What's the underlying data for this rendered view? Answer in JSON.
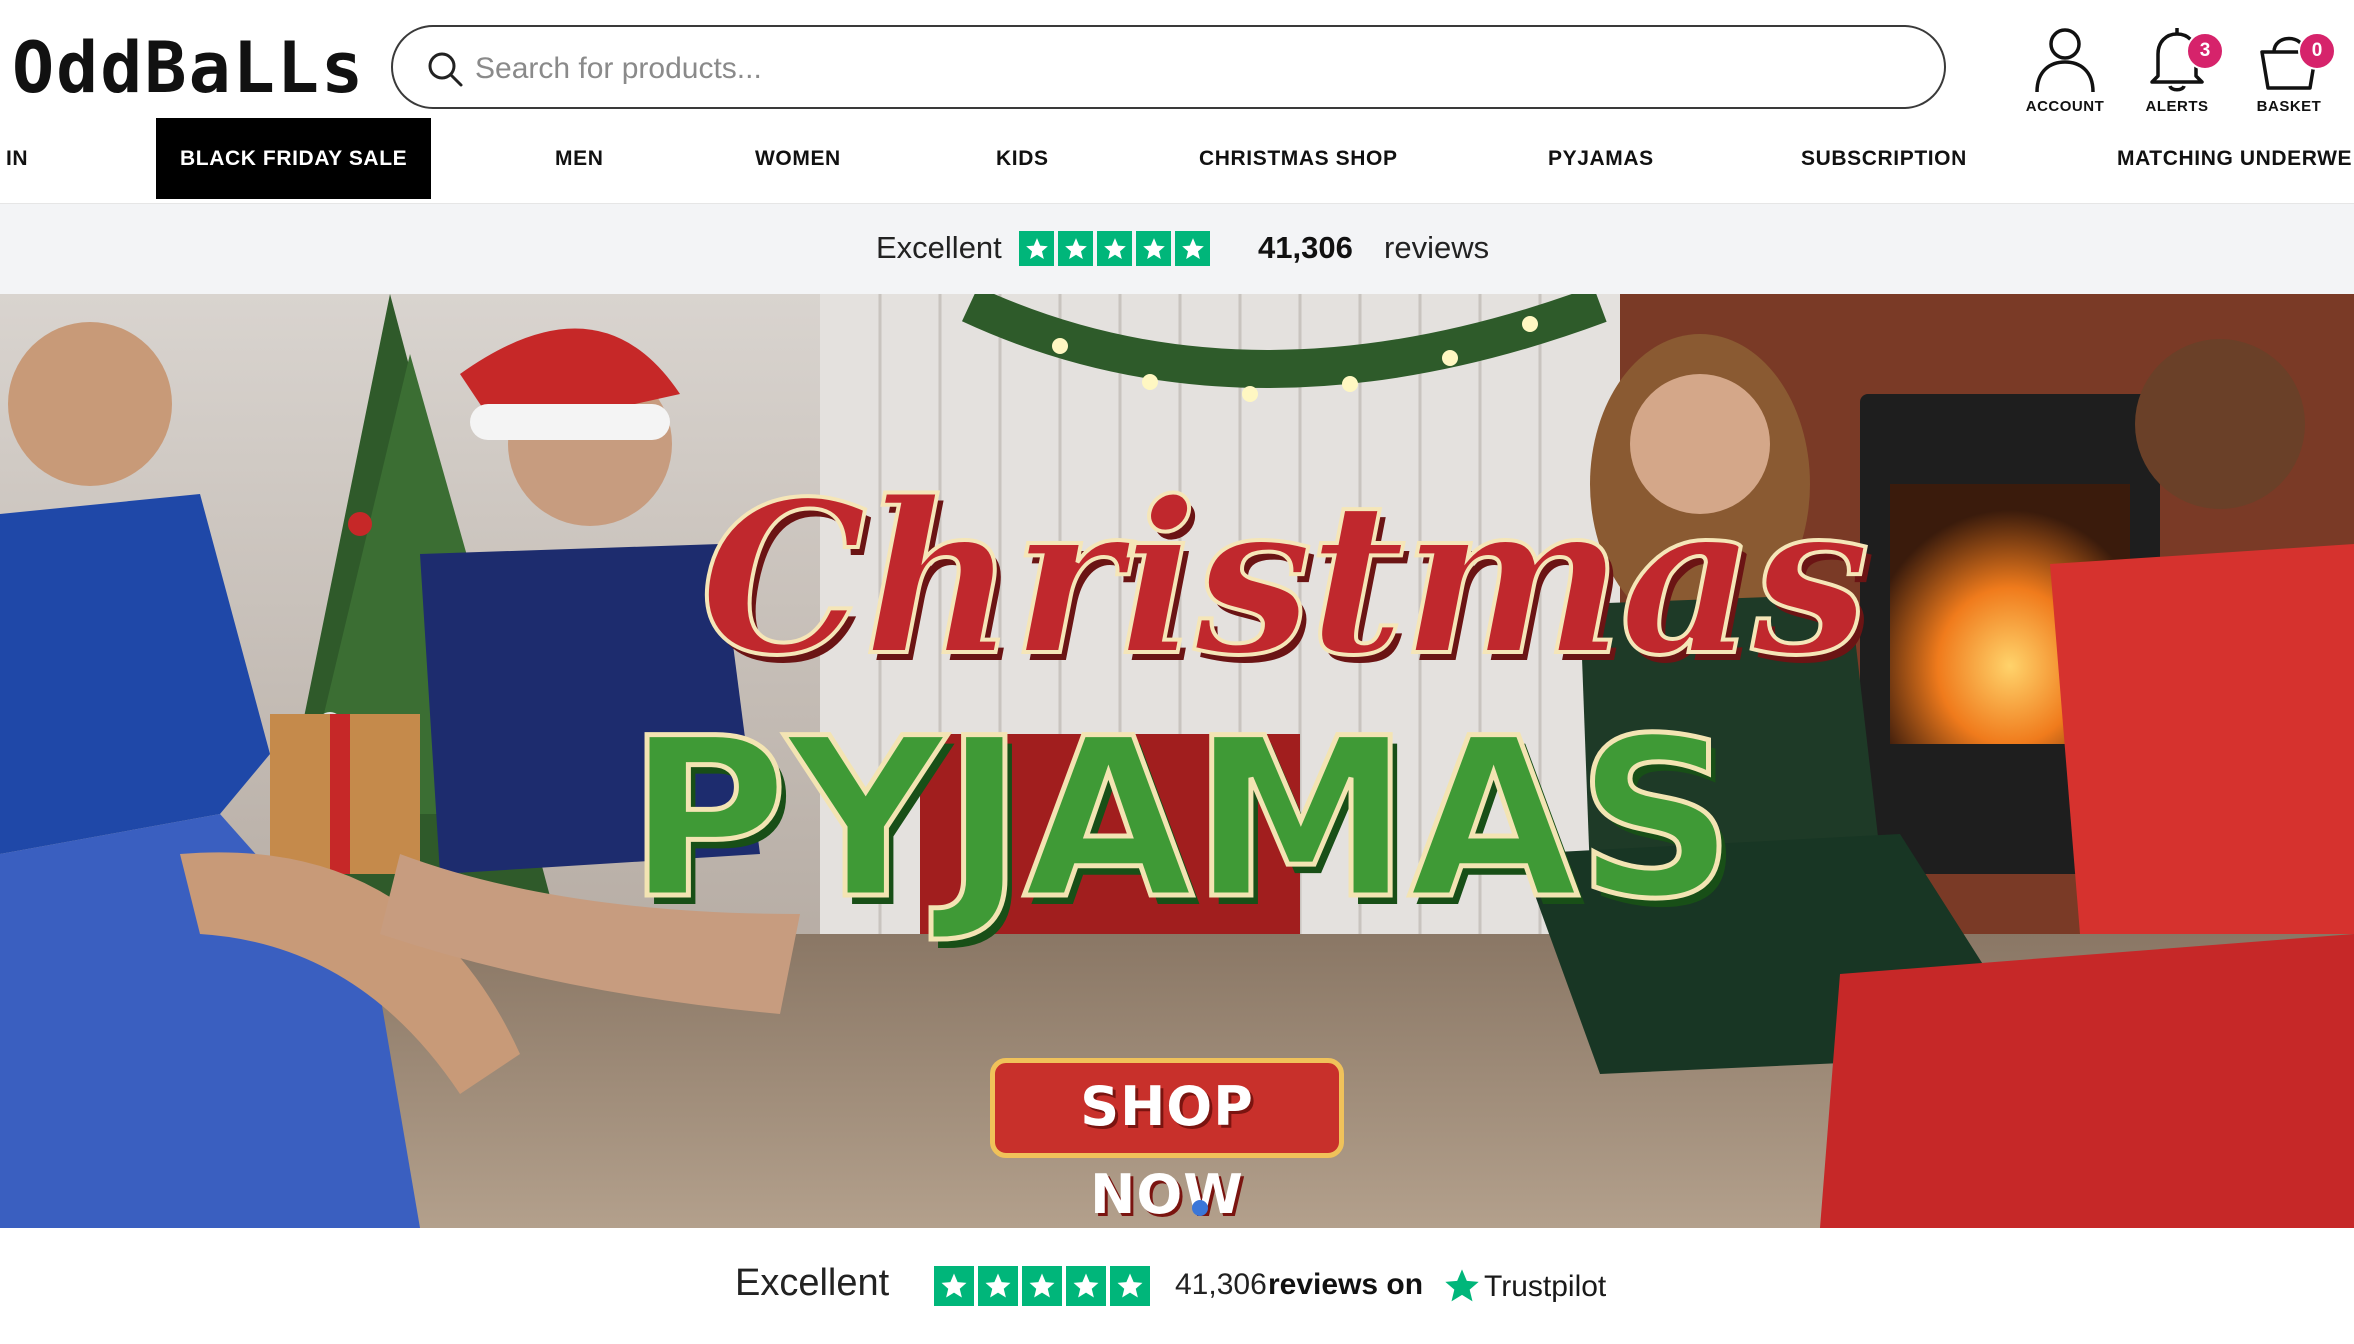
{
  "brand": {
    "logo_text": "OddBaLLs"
  },
  "search": {
    "placeholder": "Search for products..."
  },
  "header_actions": {
    "account": {
      "label": "ACCOUNT",
      "icon": "user-icon"
    },
    "alerts": {
      "label": "ALERTS",
      "icon": "bell-icon",
      "count": "3"
    },
    "basket": {
      "label": "BASKET",
      "icon": "basket-icon",
      "count": "0"
    }
  },
  "nav": {
    "items": [
      {
        "label": "IN"
      },
      {
        "label": "BLACK FRIDAY SALE",
        "active": true
      },
      {
        "label": "MEN"
      },
      {
        "label": "WOMEN"
      },
      {
        "label": "KIDS"
      },
      {
        "label": "CHRISTMAS SHOP"
      },
      {
        "label": "PYJAMAS"
      },
      {
        "label": "SUBSCRIPTION"
      },
      {
        "label": "MATCHING UNDERWE"
      }
    ]
  },
  "trust_bar": {
    "rating_text": "Excellent",
    "stars": 5,
    "reviews_count": "41,306",
    "reviews_label": "reviews"
  },
  "hero": {
    "title_line1": "Christmas",
    "title_line2": "PYJAMAS",
    "cta_label": "SHOP NOW",
    "slides_total": 1,
    "active_slide": 1
  },
  "trust_bottom": {
    "rating_text": "Excellent",
    "stars": 5,
    "reviews_count": "41,306",
    "reviews_suffix": "reviews on",
    "provider": "Trustpilot"
  },
  "colors": {
    "trustpilot_green": "#00b67a",
    "badge_pink": "#d6236b",
    "nav_active_bg": "#000000",
    "cta_red": "#c8302b"
  }
}
